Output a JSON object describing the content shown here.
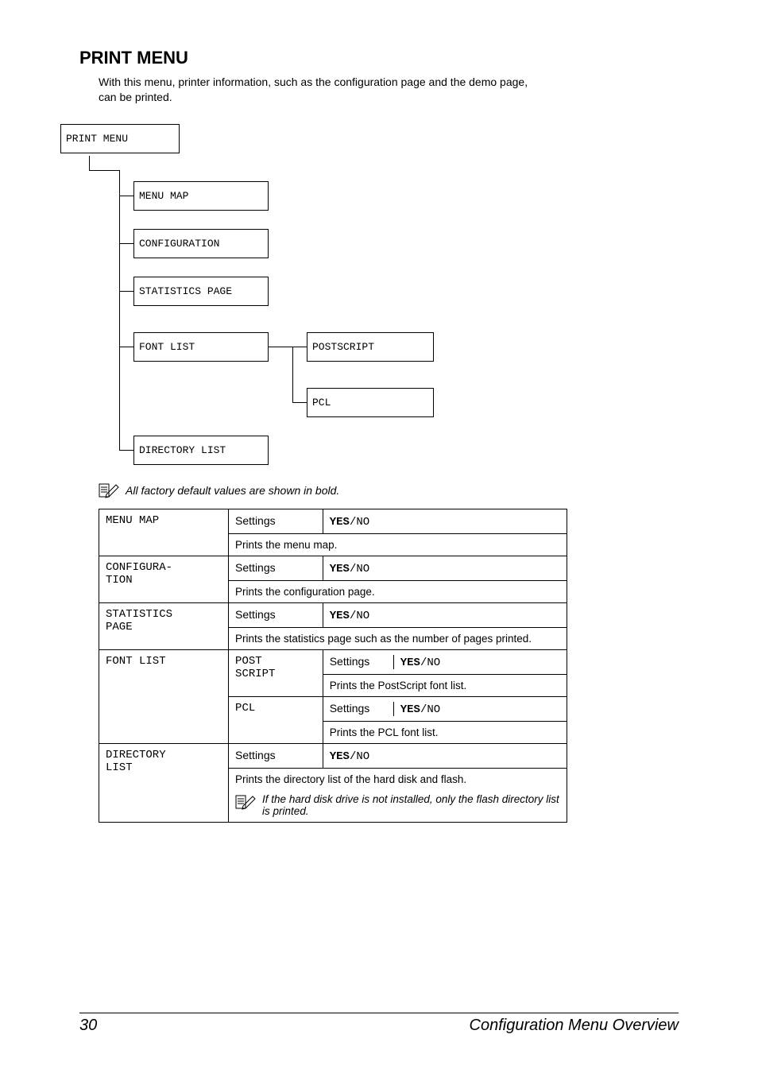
{
  "section_title": "PRINT MENU",
  "intro": "With this menu, printer information, such as the configuration page and the demo page, can be printed.",
  "tree": {
    "root": "PRINT MENU",
    "items": [
      "MENU MAP",
      "CONFIGURATION",
      "STATISTICS PAGE",
      "FONT LIST",
      "DIRECTORY LIST"
    ],
    "font_children": [
      "POSTSCRIPT",
      "PCL"
    ]
  },
  "factory_note": "All factory default values are shown in bold.",
  "settings_label": "Settings",
  "yes": "YES",
  "no": "NO",
  "sep": "/",
  "rows": {
    "menu_map": {
      "name": "MENU MAP",
      "desc": "Prints the menu map."
    },
    "configuration": {
      "name": "CONFIGURA-\nTION",
      "desc": "Prints the configuration page."
    },
    "statistics": {
      "name": "STATISTICS\nPAGE",
      "desc": "Prints the statistics page such as the number of pages printed."
    },
    "font_list": {
      "name": "FONT LIST",
      "ps_name": "POST\nSCRIPT",
      "ps_desc": "Prints the PostScript font list.",
      "pcl_name": "PCL",
      "pcl_desc": "Prints the PCL font list."
    },
    "directory": {
      "name": "DIRECTORY\nLIST",
      "desc": "Prints the directory list of the hard disk and flash.",
      "note": "If the hard disk drive is not installed, only the flash directory list is printed."
    }
  },
  "footer": {
    "page": "30",
    "title": "Configuration Menu Overview"
  }
}
